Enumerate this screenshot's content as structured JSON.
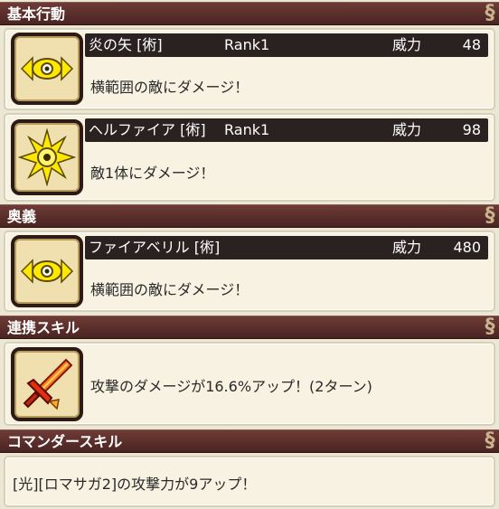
{
  "sections": {
    "basic": "基本行動",
    "ougi": "奥義",
    "link": "連携スキル",
    "commander": "コマンダースキル"
  },
  "skills": [
    {
      "name": "炎の矢 [術]",
      "rank": "Rank1",
      "power_label": "威力",
      "power": "48",
      "desc": "横範囲の敵にダメージ！",
      "icon": "eye-icon"
    },
    {
      "name": "ヘルファイア [術]",
      "rank": "Rank1",
      "power_label": "威力",
      "power": "98",
      "desc": "敵1体にダメージ！",
      "icon": "starburst-eye-icon"
    },
    {
      "name": "ファイアベリル [術]",
      "rank": "",
      "power_label": "威力",
      "power": "480",
      "desc": "横範囲の敵にダメージ！",
      "icon": "eye-icon"
    }
  ],
  "link_skill": {
    "desc": "攻撃のダメージが16.6%アップ！(2ターン)",
    "icon": "sword-icon"
  },
  "commander_skill": {
    "desc": "[光][ロマサガ2]の攻撃力が9アップ！"
  },
  "colors": {
    "header": "#5a2c28",
    "titlebar": "#2a2220",
    "card": "#f7f2e1",
    "icon_yellow": "#ffe800"
  }
}
